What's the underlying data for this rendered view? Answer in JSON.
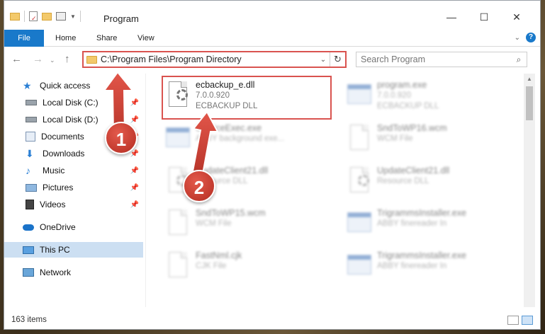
{
  "window": {
    "title": "Program",
    "controls": {
      "minimize": "—",
      "maximize": "☐",
      "close": "✕"
    }
  },
  "ribbon": {
    "tabs": [
      "File",
      "Home",
      "Share",
      "View"
    ]
  },
  "address": {
    "path": "C:\\Program Files\\Program Directory",
    "search_placeholder": "Search Program"
  },
  "sidebar": {
    "items": [
      {
        "label": "Quick access",
        "icon": "star-icon",
        "pinned": false
      },
      {
        "label": "Local Disk (C:)",
        "icon": "drive-icon",
        "pinned": true
      },
      {
        "label": "Local Disk (D:)",
        "icon": "drive-icon",
        "pinned": true
      },
      {
        "label": "Documents",
        "icon": "documents-icon",
        "pinned": true
      },
      {
        "label": "Downloads",
        "icon": "downloads-icon",
        "pinned": true
      },
      {
        "label": "Music",
        "icon": "music-icon",
        "pinned": true
      },
      {
        "label": "Pictures",
        "icon": "pictures-icon",
        "pinned": true
      },
      {
        "label": "Videos",
        "icon": "videos-icon",
        "pinned": true
      },
      {
        "label": "OneDrive",
        "icon": "onedrive-icon",
        "pinned": false
      },
      {
        "label": "This PC",
        "icon": "pc-icon",
        "pinned": false
      },
      {
        "label": "Network",
        "icon": "network-icon",
        "pinned": false
      }
    ]
  },
  "files": [
    {
      "name": "ecbackup_e.dll",
      "version": "7.0.0.920",
      "desc": "ECBACKUP DLL",
      "icon": "dll-gear-icon",
      "focused": true
    },
    {
      "name": "program.exe",
      "version": "7.0.0.920",
      "desc": "ECBACKUP DLL",
      "icon": "exe-icon",
      "focused": false
    },
    {
      "name": "ServiceExec.exe",
      "version": "",
      "desc": "ABBY background exe...",
      "icon": "exe-icon",
      "focused": false
    },
    {
      "name": "SndToWP16.wcm",
      "version": "",
      "desc": "WCM File",
      "icon": "doc-icon",
      "focused": false
    },
    {
      "name": "UpdateClient21.dll",
      "version": "",
      "desc": "Resource DLL",
      "icon": "dll-gear-icon",
      "focused": false
    },
    {
      "name": "UpdateClient21.dll",
      "version": "",
      "desc": "Resource DLL",
      "icon": "dll-gear-icon",
      "focused": false
    },
    {
      "name": "SndToWP15.wcm",
      "version": "",
      "desc": "WCM File",
      "icon": "doc-icon",
      "focused": false
    },
    {
      "name": "TrigrammsInstaller.exe",
      "version": "",
      "desc": "ABBY finereader In",
      "icon": "exe-icon",
      "focused": false
    },
    {
      "name": "FastNml.cjk",
      "version": "",
      "desc": "CJK File",
      "icon": "doc-icon",
      "focused": false
    },
    {
      "name": "TrigrammsInstaller.exe",
      "version": "",
      "desc": "ABBY finereader In",
      "icon": "exe-icon",
      "focused": false
    }
  ],
  "status": {
    "item_count": "163 items"
  },
  "annotations": {
    "badge1": "1",
    "badge2": "2"
  },
  "colors": {
    "accent": "#1979ca",
    "highlight_red": "#d9534f",
    "selected_bg": "#ccdff2"
  }
}
